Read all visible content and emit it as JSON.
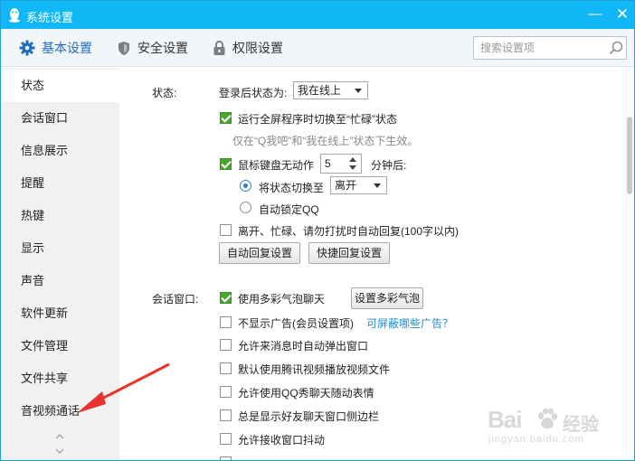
{
  "window": {
    "title": "系统设置",
    "minimize_glyph": "—",
    "close_glyph": "✕",
    "icon": "qq-penguin-icon",
    "accent_color": "#12b7f5"
  },
  "tabs": [
    {
      "label": "基本设置",
      "icon": "gear-icon",
      "active": true
    },
    {
      "label": "安全设置",
      "icon": "shield-icon",
      "active": false
    },
    {
      "label": "权限设置",
      "icon": "lock-icon",
      "active": false
    }
  ],
  "search": {
    "placeholder": "搜索设置项",
    "value": ""
  },
  "sidebar": {
    "items": [
      {
        "label": "状态",
        "active": true
      },
      {
        "label": "会话窗口"
      },
      {
        "label": "信息展示"
      },
      {
        "label": "提醒"
      },
      {
        "label": "热键"
      },
      {
        "label": "显示"
      },
      {
        "label": "声音"
      },
      {
        "label": "软件更新"
      },
      {
        "label": "文件管理"
      },
      {
        "label": "文件共享"
      },
      {
        "label": "音视频通话"
      }
    ],
    "more_icon": "double-chevron-down-icon"
  },
  "status_section": {
    "label": "状态:",
    "login_status_label": "登录后状态为:",
    "login_status_value": "我在线上",
    "fullscreen_busy": {
      "label": "运行全屏程序时切换至“忙碌”状态",
      "checked": true
    },
    "fullscreen_hint": "仅在“Q我吧”和“我在线上”状态下生效。",
    "idle": {
      "label": "鼠标键盘无动作",
      "checked": true,
      "minutes": "5",
      "suffix": "分钟后:"
    },
    "switch_to": {
      "label": "将状态切换至",
      "value": "离开",
      "selected": true
    },
    "auto_lock": {
      "label": "自动锁定QQ",
      "selected": false
    },
    "auto_reply": {
      "label": "离开、忙碌、请勿打扰时自动回复(100字以内)",
      "checked": false
    },
    "auto_reply_btn": "自动回复设置",
    "quick_reply_btn": "快捷回复设置"
  },
  "chat_section": {
    "label": "会话窗口:",
    "options": [
      {
        "label": "使用多彩气泡聊天",
        "checked": true
      },
      {
        "label": "不显示广告(会员设置项)",
        "checked": false
      },
      {
        "label": "允许来消息时自动弹出窗口",
        "checked": false
      },
      {
        "label": "默认使用腾讯视频播放视频文件",
        "checked": false
      },
      {
        "label": "允许使用QQ秀聊天随动表情",
        "checked": false
      },
      {
        "label": "总是显示好友聊天窗口侧边栏",
        "checked": false
      },
      {
        "label": "允许接收窗口抖动",
        "checked": false
      }
    ],
    "bubble_btn": "设置多彩气泡",
    "ad_link": "可屏蔽哪些广告？"
  },
  "watermark": {
    "brand": "Bai",
    "suffix": "经验",
    "url": "jingyan.baidu.com"
  },
  "annotation": {
    "arrow_color": "#e8322c"
  }
}
